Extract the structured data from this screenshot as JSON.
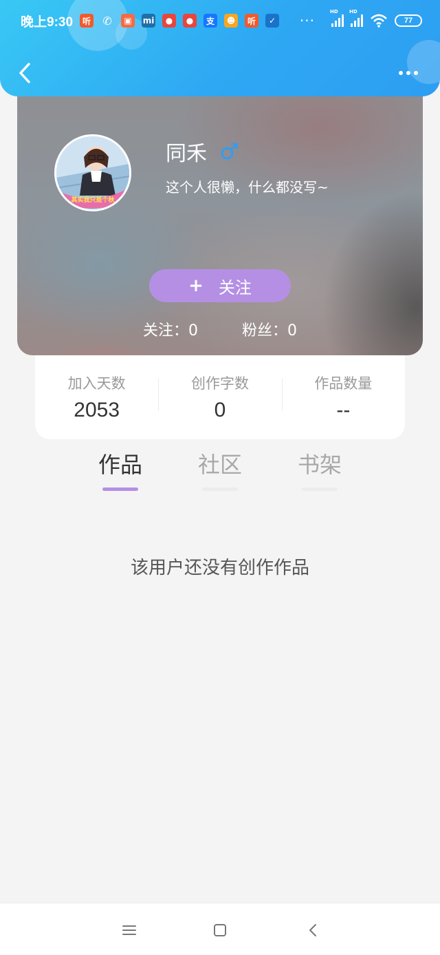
{
  "status_bar": {
    "time": "晚上9:30",
    "notification_icons": [
      {
        "name": "ting-app-icon",
        "glyph": "听",
        "color": "#f05a2c"
      },
      {
        "name": "wechat-icon",
        "glyph": "✆",
        "color": "#ffffff"
      },
      {
        "name": "shop-app-icon",
        "glyph": "▣",
        "color": "#f46b45"
      },
      {
        "name": "mi-app-icon",
        "glyph": "mi",
        "color": "#1f6fa8"
      },
      {
        "name": "map-pin-app-icon",
        "glyph": "●",
        "color": "#e8453c"
      },
      {
        "name": "map-pin-app-icon-2",
        "glyph": "●",
        "color": "#e8453c"
      },
      {
        "name": "alipay-icon",
        "glyph": "支",
        "color": "#1677ff"
      },
      {
        "name": "game-app-icon",
        "glyph": "☻",
        "color": "#f6a623"
      },
      {
        "name": "ting-app-icon-2",
        "glyph": "听",
        "color": "#f05a2c"
      },
      {
        "name": "check-badge-icon",
        "glyph": "✓",
        "color": "#1a73c8"
      }
    ],
    "more": "···",
    "signal_label": "HD",
    "battery": "77"
  },
  "profile": {
    "nickname": "同禾",
    "gender_symbol": "♂",
    "bio": "这个人很懒，什么都没写~",
    "avatar_caption": "其实我只是个秋",
    "follow_plus": "+",
    "follow_label": "关注",
    "following": "关注：0",
    "fans": "粉丝：0"
  },
  "stats": [
    {
      "label": "加入天数",
      "value": "2053"
    },
    {
      "label": "创作字数",
      "value": "0"
    },
    {
      "label": "作品数量",
      "value": "--"
    }
  ],
  "tabs": [
    {
      "label": "作品",
      "active": true
    },
    {
      "label": "社区",
      "active": false
    },
    {
      "label": "书架",
      "active": false
    }
  ],
  "empty_message": "该用户还没有创作作品",
  "colors": {
    "header": "#2ea8f3",
    "accent": "#b58fe4",
    "male": "#2d9ef2"
  }
}
